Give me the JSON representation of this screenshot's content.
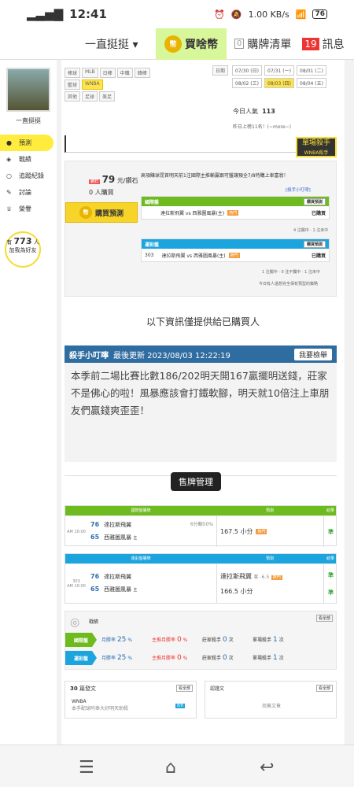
{
  "status": {
    "time": "12:41",
    "net": "1.00 KB/s",
    "battery": "76"
  },
  "nav": {
    "dropdown": "一直挺挺",
    "buy": "買啥幣",
    "buy_icon": "幣",
    "list": "購牌清單",
    "list_count": "0",
    "msg": "訊息",
    "msg_count": "19"
  },
  "sidebar": {
    "username": "一直挺挺",
    "items": [
      "預測",
      "戰績",
      "追蹤紀錄",
      "討論",
      "榮譽"
    ],
    "bubble_pre": "有",
    "bubble_num": "773",
    "bubble_unit": "人",
    "bubble_post": "加我為好友"
  },
  "tags": {
    "label1": "棒球",
    "sports": [
      "MLB",
      "日棒",
      "中職",
      "韓棒"
    ],
    "label2": "籃球",
    "bball": [
      "WNBA"
    ],
    "label3": "其他",
    "other": [
      "足球",
      "美足"
    ],
    "date_label": "日期",
    "dates": [
      "07/30 (日)",
      "07/31 (一)",
      "08/01 (二)",
      "08/02 (三)",
      "08/03 (四)",
      "08/04 (五)"
    ]
  },
  "today": {
    "label": "今日人氣",
    "value": "113",
    "rank": "昨日上榜11名！(~more~)"
  },
  "badge": {
    "text": "單場殺手",
    "sub": "WNBA殺手"
  },
  "pred": {
    "diamond": "79",
    "diamond_label": "鑽石",
    "diamond_unit": "元/鑽石",
    "buyers": "0",
    "buyers_label": "人購買",
    "buy_label": "購買預測",
    "intro": "高項賺球昆首明天前1注國際主推輸贏跟可盤讓預全7/8特購上車富翁！",
    "follow": "[殺手小叮嚀]",
    "intl_title": "國際盤",
    "intl_btn": "購買預測",
    "intl_row": {
      "teams": "達拉斯飛翼 vs 西雅圖風暴(主)",
      "chip": "熱門",
      "result": "已購買"
    },
    "intl_note": "4 注獨中 · 1 注未中",
    "tw_title": "運彩盤",
    "tw_btn": "購買預測",
    "tw_row": {
      "num": "303",
      "teams": "達拉斯飛翼 vs 西雅圖風暴(主)",
      "chip": "熱門",
      "result": "已購買"
    },
    "tw_note": "1 注獨中 · 0 注不獨中 · 1 注未中",
    "foot": "今日有人還想完全保有預型的策略"
  },
  "notice": "以下資訊僅提供給已購買人",
  "killer": {
    "title": "殺手小叮嚀",
    "updated": "最後更新 2023/08/03 12:22:19",
    "btn": "我要檢舉",
    "body": "本季前二場比賽比數186/202明天開167贏擺明送錢，莊家不是佛心的啦！風暴應該會打鐵軟腳，明天就10倍注上車朋友們贏錢爽歪歪！"
  },
  "mgmt": "售牌管理",
  "intl_table": {
    "head": [
      "國際盤購牌",
      "預測",
      "結果"
    ],
    "time": "AM 10:00",
    "away_no": "76",
    "away": "達拉斯飛翼",
    "home_no": "65",
    "home": "西雅圖風暴",
    "home_tag": "主",
    "odds": "6分輸50%",
    "pick": "167.5 小分",
    "chip": "熱門",
    "result": "準"
  },
  "tw_table": {
    "head": [
      "運彩盤購牌",
      "預測",
      "結果"
    ],
    "no": "303",
    "time": "AM 10:00",
    "away_no": "76",
    "away": "達拉斯飛翼",
    "home_no": "65",
    "home": "西雅圖風暴",
    "home_tag": "主",
    "pick1": "達拉斯飛翼",
    "pick1_odds": "客 -6.5",
    "pick2": "166.5 小分",
    "chip": "熱門",
    "r1": "準",
    "r2": "準"
  },
  "stats": {
    "title": "戰績",
    "seeall": "看全部",
    "rows": [
      {
        "label": "國際盤",
        "cols": [
          [
            "月勝率",
            "25",
            "%"
          ],
          [
            "主推月勝率",
            "0",
            "%"
          ],
          [
            "莊家殺手",
            "0",
            "次"
          ],
          [
            "單場殺手",
            "1",
            "次"
          ]
        ]
      },
      {
        "label": "運彩盤",
        "cols": [
          [
            "月勝率",
            "25",
            "%"
          ],
          [
            "主推月勝率",
            "0",
            "%"
          ],
          [
            "莊家殺手",
            "0",
            "次"
          ],
          [
            "單場殺手",
            "1",
            "次"
          ]
        ]
      }
    ]
  },
  "posts": {
    "count": "30",
    "label": "篇發文",
    "seeall": "看全部",
    "item_cat": "WNBA",
    "item_text": "本手配球阿奉大好明天助殺",
    "item_date": "8/8"
  },
  "replies": {
    "label": "認證文",
    "seeall": "看全部",
    "empty": "尚無文章"
  },
  "colors": {
    "green": "#6dbb1f",
    "blue": "#1ba4dd",
    "yellow": "#ffe34d"
  }
}
